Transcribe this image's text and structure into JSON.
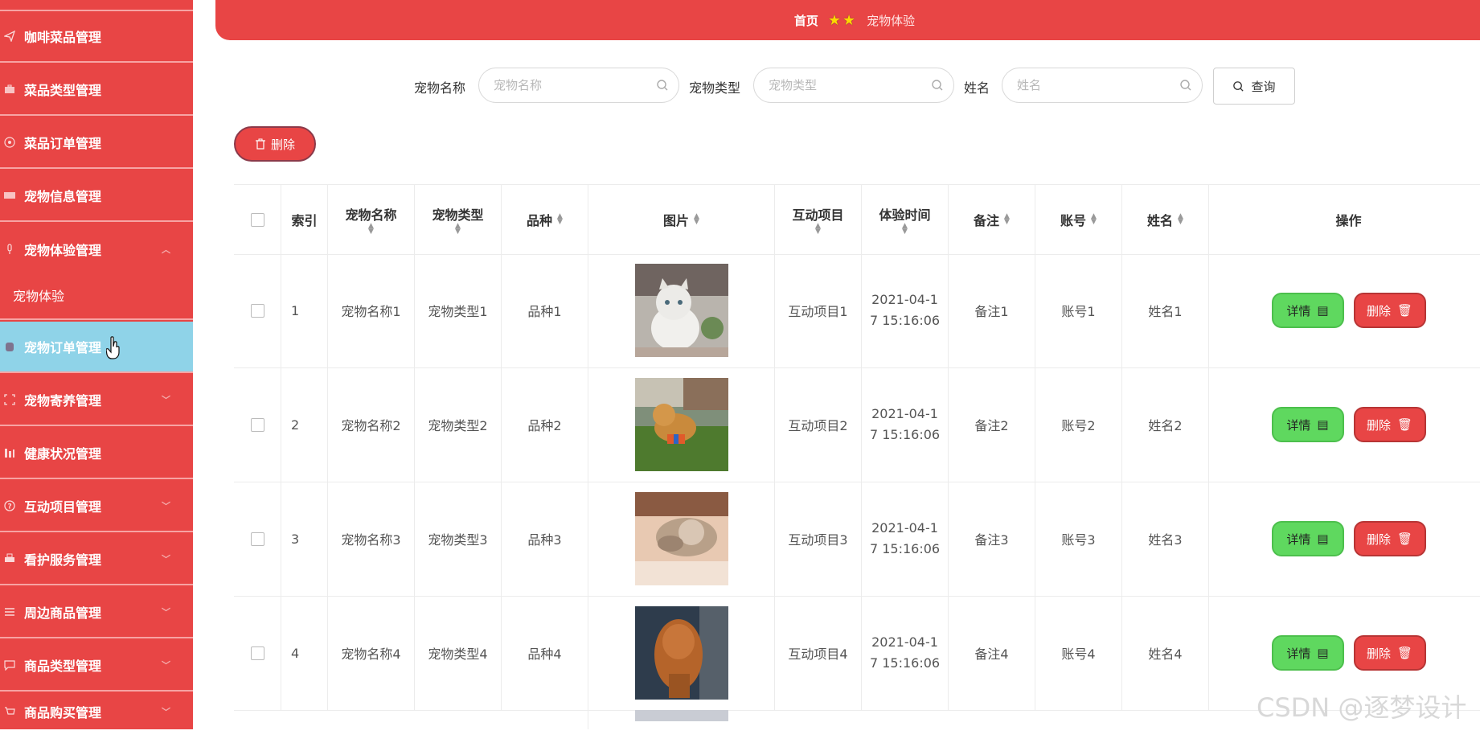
{
  "sidebar": {
    "items": [
      {
        "label": "咖啡菜品管理",
        "icon": "send-icon",
        "arrow": ""
      },
      {
        "label": "菜品类型管理",
        "icon": "briefcase-icon",
        "arrow": ""
      },
      {
        "label": "菜品订单管理",
        "icon": "dial-icon",
        "arrow": ""
      },
      {
        "label": "宠物信息管理",
        "icon": "ticket-icon",
        "arrow": ""
      },
      {
        "label": "宠物体验管理",
        "icon": "microphone-icon",
        "arrow": "︿"
      },
      {
        "label": "宠物体验",
        "icon": "",
        "arrow": ""
      },
      {
        "label": "宠物订单管理",
        "icon": "cylinder-icon",
        "arrow": ""
      },
      {
        "label": "宠物寄养管理",
        "icon": "frame-icon",
        "arrow": "﹀"
      },
      {
        "label": "健康状况管理",
        "icon": "bar-icon",
        "arrow": ""
      },
      {
        "label": "互动项目管理",
        "icon": "circle-icon",
        "arrow": "﹀"
      },
      {
        "label": "看护服务管理",
        "icon": "printer-icon",
        "arrow": "﹀"
      },
      {
        "label": "周边商品管理",
        "icon": "list-icon",
        "arrow": "﹀"
      },
      {
        "label": "商品类型管理",
        "icon": "chat-icon",
        "arrow": "﹀"
      },
      {
        "label": "商品购买管理",
        "icon": "cart-icon",
        "arrow": "﹀"
      }
    ]
  },
  "breadcrumb": {
    "home": "首页",
    "current": "宠物体验"
  },
  "search": {
    "pet_name_label": "宠物名称",
    "pet_name_placeholder": "宠物名称",
    "pet_type_label": "宠物类型",
    "pet_type_placeholder": "宠物类型",
    "name_label": "姓名",
    "name_placeholder": "姓名",
    "query_label": "查询"
  },
  "toolbar": {
    "delete_label": "删除"
  },
  "table": {
    "headers": [
      "索引",
      "宠物名称",
      "宠物类型",
      "品种",
      "图片",
      "互动项目",
      "体验时间",
      "备注",
      "账号",
      "姓名",
      "操作"
    ],
    "rows": [
      {
        "index": "1",
        "pet_name": "宠物名称1",
        "pet_type": "宠物类型1",
        "breed": "品种1",
        "project": "互动项目1",
        "time1": "2021-04-1",
        "time2": "7 15:16:06",
        "remark": "备注1",
        "account": "账号1",
        "name": "姓名1"
      },
      {
        "index": "2",
        "pet_name": "宠物名称2",
        "pet_type": "宠物类型2",
        "breed": "品种2",
        "project": "互动项目2",
        "time1": "2021-04-1",
        "time2": "7 15:16:06",
        "remark": "备注2",
        "account": "账号2",
        "name": "姓名2"
      },
      {
        "index": "3",
        "pet_name": "宠物名称3",
        "pet_type": "宠物类型3",
        "breed": "品种3",
        "project": "互动项目3",
        "time1": "2021-04-1",
        "time2": "7 15:16:06",
        "remark": "备注3",
        "account": "账号3",
        "name": "姓名3"
      },
      {
        "index": "4",
        "pet_name": "宠物名称4",
        "pet_type": "宠物类型4",
        "breed": "品种4",
        "project": "互动项目4",
        "time1": "2021-04-1",
        "time2": "7 15:16:06",
        "remark": "备注4",
        "account": "账号4",
        "name": "姓名4"
      }
    ],
    "detail_label": "详情",
    "delete_label": "删除"
  },
  "watermark": "CSDN @逐梦设计",
  "colors": {
    "accent": "#e84545",
    "active": "#8fd3e8",
    "success": "#5fd85f"
  }
}
